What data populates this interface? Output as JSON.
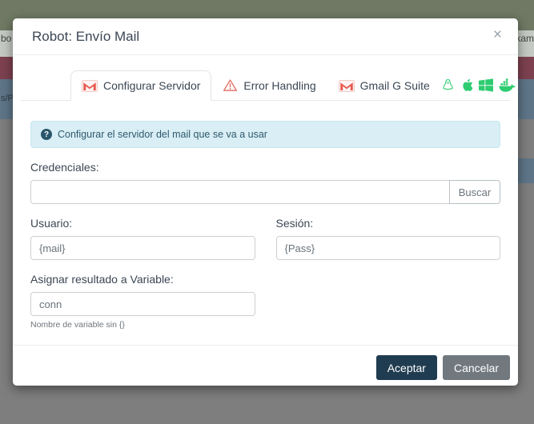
{
  "backdrop": {
    "top_left_fragment": "bo",
    "top_right_fragment": "kam",
    "side_left_fragment": "s/P"
  },
  "modal": {
    "title": "Robot: Envío Mail",
    "close_label": "×",
    "tabs": [
      {
        "label": "Configurar Servidor",
        "icon": "gmail",
        "active": true
      },
      {
        "label": "Error Handling",
        "icon": "warning-triangle",
        "active": false
      },
      {
        "label": "Gmail G Suite",
        "icon": "gmail",
        "active": false
      }
    ],
    "platform_icons": [
      "linux",
      "apple",
      "windows",
      "docker"
    ],
    "info_banner": {
      "icon": "question-circle",
      "text": "Configurar el servidor del mail que se va a usar"
    },
    "fields": {
      "credentials": {
        "label": "Credenciales:",
        "value": "",
        "button_label": "Buscar"
      },
      "user": {
        "label": "Usuario:",
        "value": "{mail}"
      },
      "session": {
        "label": "Sesión:",
        "value": "{Pass}"
      },
      "variable": {
        "label": "Asignar resultado a Variable:",
        "value": "conn",
        "help": "Nombre de variable sin {}"
      }
    },
    "footer": {
      "accept_label": "Aceptar",
      "cancel_label": "Cancelar"
    },
    "colors": {
      "gmail_red": "#e8594f",
      "warning_red": "#e5756e",
      "platform_green": "#2ecc71",
      "banner_bg": "#d9eef5",
      "accept_bg": "#203c50",
      "cancel_bg": "#71797f"
    }
  }
}
